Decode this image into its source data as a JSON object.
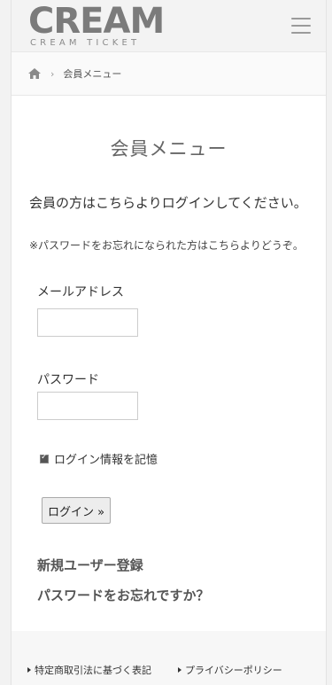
{
  "header": {
    "logo_main": "CREAM",
    "logo_sub": "CREAM TICKET",
    "menu_icon": "hamburger-menu-icon"
  },
  "breadcrumb": {
    "home_icon": "home-icon",
    "separator": "›",
    "current": "会員メニュー"
  },
  "main": {
    "title": "会員メニュー",
    "intro": "会員の方はこちらよりログインしてください。",
    "note": "※パスワードをお忘れになられた方はこちらよりどうぞ。",
    "email_label": "メールアドレス",
    "email_value": "",
    "password_label": "パスワード",
    "password_value": "",
    "remember_label": "ログイン情報を記憶",
    "remember_checked": true,
    "login_button": "ログイン »",
    "register_link": "新規ユーザー登録",
    "forgot_link": "パスワードをお忘れですか？"
  },
  "footer": {
    "link1": "特定商取引法に基づく表記",
    "link2": "プライバシーポリシー"
  },
  "colors": {
    "logo": "#7b7b7b",
    "background": "#f2f2f2",
    "content": "#ffffff"
  }
}
